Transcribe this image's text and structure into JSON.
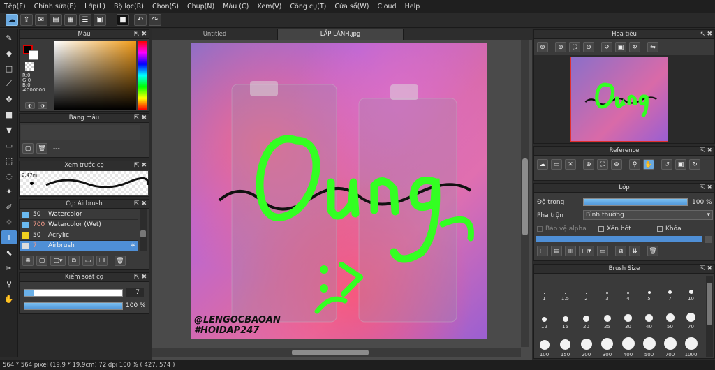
{
  "menu": [
    "Tệp(F)",
    "Chỉnh sửa(E)",
    "Lớp(L)",
    "Bộ lọc(R)",
    "Chọn(S)",
    "Chụp(N)",
    "Màu (C)",
    "Xem(V)",
    "Công cụ(T)",
    "Cửa sổ(W)",
    "Cloud",
    "Help"
  ],
  "tabs": [
    {
      "label": "Untitled"
    },
    {
      "label": "LẤP LÁNH.jpg"
    }
  ],
  "color_panel": {
    "title": "Màu",
    "r": "R:0",
    "g": "G:0",
    "b": "B:0",
    "hex": "#000000",
    "fg": "#000000"
  },
  "palette_panel": {
    "title": "Bảng màu",
    "dash": "---"
  },
  "brush_preview": {
    "title": "Xem trước cọ",
    "size": "2.47m"
  },
  "brush_panel": {
    "title": "Cọ: Airbrush",
    "items": [
      {
        "num": "50",
        "name": "Watercolor",
        "color": "#6ab9f0"
      },
      {
        "num": "700",
        "name": "Watercolor (Wet)",
        "color": "#6ab9f0"
      },
      {
        "num": "50",
        "name": "Acrylic",
        "color": "#f0d020"
      },
      {
        "num": "7",
        "name": "Airbrush",
        "color": "#dddddd"
      }
    ]
  },
  "brush_control": {
    "title": "Kiểm soát cọ",
    "size": "7",
    "opacity": "100 %",
    "size_fraction": 0.1,
    "opacity_fraction": 1.0
  },
  "navigator": {
    "title": "Hoa tiêu"
  },
  "reference": {
    "title": "Reference"
  },
  "layer_panel": {
    "title": "Lớp",
    "opacity_label": "Độ trong",
    "opacity_value": "100 %",
    "blend_label": "Pha trộn",
    "blend_value": "Bình thường",
    "protect_alpha": "Bảo vệ alpha",
    "clip": "Xén bớt",
    "lock": "Khóa"
  },
  "brush_size": {
    "title": "Brush Size",
    "sizes": [
      "1",
      "1.5",
      "2",
      "3",
      "4",
      "5",
      "7",
      "10",
      "12",
      "15",
      "20",
      "25",
      "30",
      "40",
      "50",
      "70",
      "100",
      "150",
      "200",
      "300",
      "400",
      "500",
      "700",
      "1000"
    ]
  },
  "canvas_text": {
    "word": "Oung",
    "smile": ":>",
    "credit1": "@LENGOCBAOAN",
    "credit2": "#HOIDAP247"
  },
  "status": "564 * 564 pixel  (19.9 * 19.9cm)  72 dpi  100 %  ( 427, 574 )",
  "colors": {
    "accent": "#4f8fd6",
    "stroke_green": "#33ff22",
    "panel_bg": "#3a3a3a"
  }
}
